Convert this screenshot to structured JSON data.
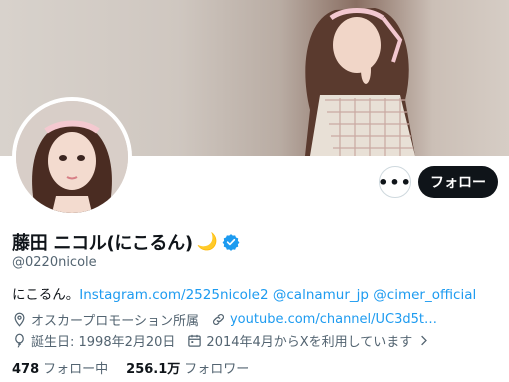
{
  "profile": {
    "display_name": "藤田 ニコル(にこるん)",
    "name_emoji": "🌙",
    "handle": "@0220nicole",
    "bio_prefix": "にこるん。",
    "bio_links": [
      "Instagram.com/2525nicole2",
      "@calnamur_jp",
      "@cimer_official"
    ],
    "location": "オスカープロモーション所属",
    "website": "youtube.com/channel/UC3d5t…",
    "birthday": "誕生日: 1998年2月20日",
    "joined": "2014年4月からXを利用しています",
    "following_count": "478",
    "following_label": "フォロー中",
    "followers_count": "256.1万",
    "followers_label": "フォロワー"
  },
  "actions": {
    "more": "•••",
    "follow": "フォロー"
  },
  "icons": {
    "location": "location-pin-icon",
    "link": "link-icon",
    "birthday": "balloon-icon",
    "calendar": "calendar-icon",
    "verified": "verified-badge-icon",
    "more": "more-icon"
  },
  "colors": {
    "accent": "#1d9bf0",
    "text": "#0f1419",
    "muted": "#536471",
    "follow_button": "#0f1419"
  }
}
